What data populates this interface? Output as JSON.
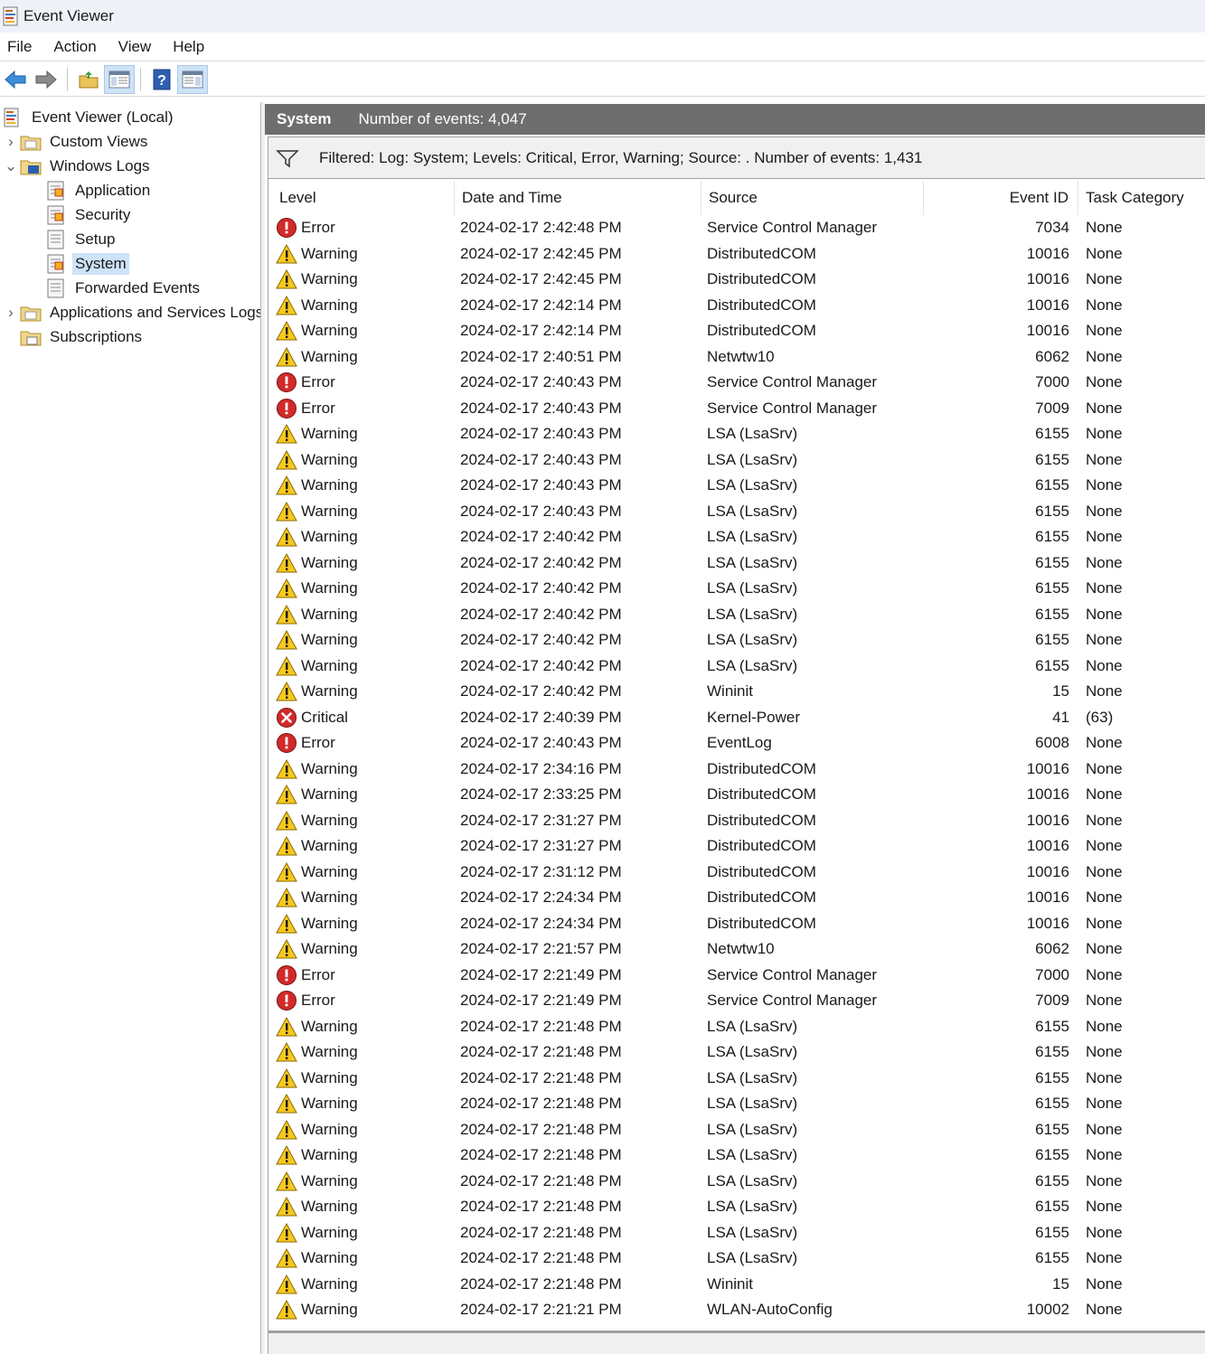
{
  "window": {
    "title": "Event Viewer"
  },
  "menu": [
    "File",
    "Action",
    "View",
    "Help"
  ],
  "toolbar": {
    "buttons": [
      "back-arrow-icon",
      "forward-arrow-icon",
      "open-folder-icon",
      "show-hide-tree-icon",
      "help-icon",
      "show-hide-action-pane-icon"
    ]
  },
  "tree": {
    "items": [
      {
        "label": "Event Viewer (Local)",
        "icon": "event-viewer-icon",
        "level": 0,
        "chevron": ""
      },
      {
        "label": "Custom Views",
        "icon": "folder-icon",
        "level": 1,
        "chevron": "›"
      },
      {
        "label": "Windows Logs",
        "icon": "windows-logs-folder-icon",
        "level": 1,
        "chevron": "⌄"
      },
      {
        "label": "Application",
        "icon": "log-icon",
        "level": 2,
        "chevron": ""
      },
      {
        "label": "Security",
        "icon": "log-icon",
        "level": 2,
        "chevron": ""
      },
      {
        "label": "Setup",
        "icon": "log-icon",
        "level": 2,
        "chevron": ""
      },
      {
        "label": "System",
        "icon": "log-icon",
        "level": 2,
        "chevron": "",
        "selected": true
      },
      {
        "label": "Forwarded Events",
        "icon": "log-icon",
        "level": 2,
        "chevron": ""
      },
      {
        "label": "Applications and Services Logs",
        "icon": "folder-icon",
        "level": 1,
        "chevron": "›"
      },
      {
        "label": "Subscriptions",
        "icon": "subscriptions-icon",
        "level": 1,
        "chevron": ""
      }
    ]
  },
  "log_header": {
    "name": "System",
    "count": "Number of events: 4,047"
  },
  "filter": {
    "text": "Filtered: Log: System; Levels: Critical, Error, Warning; Source: . Number of events: 1,431"
  },
  "columns": [
    "Level",
    "Date and Time",
    "Source",
    "Event ID",
    "Task Category"
  ],
  "colors": {
    "warning": "#f7c81e",
    "error": "#d12a2a",
    "critical": "#d12a2a",
    "selection": "#cde3f7",
    "header": "#6e6e6e"
  },
  "events": [
    {
      "level": "Error",
      "datetime": "2024-02-17 2:42:48 PM",
      "source": "Service Control Manager",
      "event_id": "7034",
      "category": "None"
    },
    {
      "level": "Warning",
      "datetime": "2024-02-17 2:42:45 PM",
      "source": "DistributedCOM",
      "event_id": "10016",
      "category": "None"
    },
    {
      "level": "Warning",
      "datetime": "2024-02-17 2:42:45 PM",
      "source": "DistributedCOM",
      "event_id": "10016",
      "category": "None"
    },
    {
      "level": "Warning",
      "datetime": "2024-02-17 2:42:14 PM",
      "source": "DistributedCOM",
      "event_id": "10016",
      "category": "None"
    },
    {
      "level": "Warning",
      "datetime": "2024-02-17 2:42:14 PM",
      "source": "DistributedCOM",
      "event_id": "10016",
      "category": "None"
    },
    {
      "level": "Warning",
      "datetime": "2024-02-17 2:40:51 PM",
      "source": "Netwtw10",
      "event_id": "6062",
      "category": "None"
    },
    {
      "level": "Error",
      "datetime": "2024-02-17 2:40:43 PM",
      "source": "Service Control Manager",
      "event_id": "7000",
      "category": "None"
    },
    {
      "level": "Error",
      "datetime": "2024-02-17 2:40:43 PM",
      "source": "Service Control Manager",
      "event_id": "7009",
      "category": "None"
    },
    {
      "level": "Warning",
      "datetime": "2024-02-17 2:40:43 PM",
      "source": "LSA (LsaSrv)",
      "event_id": "6155",
      "category": "None"
    },
    {
      "level": "Warning",
      "datetime": "2024-02-17 2:40:43 PM",
      "source": "LSA (LsaSrv)",
      "event_id": "6155",
      "category": "None"
    },
    {
      "level": "Warning",
      "datetime": "2024-02-17 2:40:43 PM",
      "source": "LSA (LsaSrv)",
      "event_id": "6155",
      "category": "None"
    },
    {
      "level": "Warning",
      "datetime": "2024-02-17 2:40:43 PM",
      "source": "LSA (LsaSrv)",
      "event_id": "6155",
      "category": "None"
    },
    {
      "level": "Warning",
      "datetime": "2024-02-17 2:40:42 PM",
      "source": "LSA (LsaSrv)",
      "event_id": "6155",
      "category": "None"
    },
    {
      "level": "Warning",
      "datetime": "2024-02-17 2:40:42 PM",
      "source": "LSA (LsaSrv)",
      "event_id": "6155",
      "category": "None"
    },
    {
      "level": "Warning",
      "datetime": "2024-02-17 2:40:42 PM",
      "source": "LSA (LsaSrv)",
      "event_id": "6155",
      "category": "None"
    },
    {
      "level": "Warning",
      "datetime": "2024-02-17 2:40:42 PM",
      "source": "LSA (LsaSrv)",
      "event_id": "6155",
      "category": "None"
    },
    {
      "level": "Warning",
      "datetime": "2024-02-17 2:40:42 PM",
      "source": "LSA (LsaSrv)",
      "event_id": "6155",
      "category": "None"
    },
    {
      "level": "Warning",
      "datetime": "2024-02-17 2:40:42 PM",
      "source": "LSA (LsaSrv)",
      "event_id": "6155",
      "category": "None"
    },
    {
      "level": "Warning",
      "datetime": "2024-02-17 2:40:42 PM",
      "source": "Wininit",
      "event_id": "15",
      "category": "None"
    },
    {
      "level": "Critical",
      "datetime": "2024-02-17 2:40:39 PM",
      "source": "Kernel-Power",
      "event_id": "41",
      "category": "(63)"
    },
    {
      "level": "Error",
      "datetime": "2024-02-17 2:40:43 PM",
      "source": "EventLog",
      "event_id": "6008",
      "category": "None"
    },
    {
      "level": "Warning",
      "datetime": "2024-02-17 2:34:16 PM",
      "source": "DistributedCOM",
      "event_id": "10016",
      "category": "None"
    },
    {
      "level": "Warning",
      "datetime": "2024-02-17 2:33:25 PM",
      "source": "DistributedCOM",
      "event_id": "10016",
      "category": "None"
    },
    {
      "level": "Warning",
      "datetime": "2024-02-17 2:31:27 PM",
      "source": "DistributedCOM",
      "event_id": "10016",
      "category": "None"
    },
    {
      "level": "Warning",
      "datetime": "2024-02-17 2:31:27 PM",
      "source": "DistributedCOM",
      "event_id": "10016",
      "category": "None"
    },
    {
      "level": "Warning",
      "datetime": "2024-02-17 2:31:12 PM",
      "source": "DistributedCOM",
      "event_id": "10016",
      "category": "None"
    },
    {
      "level": "Warning",
      "datetime": "2024-02-17 2:24:34 PM",
      "source": "DistributedCOM",
      "event_id": "10016",
      "category": "None"
    },
    {
      "level": "Warning",
      "datetime": "2024-02-17 2:24:34 PM",
      "source": "DistributedCOM",
      "event_id": "10016",
      "category": "None"
    },
    {
      "level": "Warning",
      "datetime": "2024-02-17 2:21:57 PM",
      "source": "Netwtw10",
      "event_id": "6062",
      "category": "None"
    },
    {
      "level": "Error",
      "datetime": "2024-02-17 2:21:49 PM",
      "source": "Service Control Manager",
      "event_id": "7000",
      "category": "None"
    },
    {
      "level": "Error",
      "datetime": "2024-02-17 2:21:49 PM",
      "source": "Service Control Manager",
      "event_id": "7009",
      "category": "None"
    },
    {
      "level": "Warning",
      "datetime": "2024-02-17 2:21:48 PM",
      "source": "LSA (LsaSrv)",
      "event_id": "6155",
      "category": "None"
    },
    {
      "level": "Warning",
      "datetime": "2024-02-17 2:21:48 PM",
      "source": "LSA (LsaSrv)",
      "event_id": "6155",
      "category": "None"
    },
    {
      "level": "Warning",
      "datetime": "2024-02-17 2:21:48 PM",
      "source": "LSA (LsaSrv)",
      "event_id": "6155",
      "category": "None"
    },
    {
      "level": "Warning",
      "datetime": "2024-02-17 2:21:48 PM",
      "source": "LSA (LsaSrv)",
      "event_id": "6155",
      "category": "None"
    },
    {
      "level": "Warning",
      "datetime": "2024-02-17 2:21:48 PM",
      "source": "LSA (LsaSrv)",
      "event_id": "6155",
      "category": "None"
    },
    {
      "level": "Warning",
      "datetime": "2024-02-17 2:21:48 PM",
      "source": "LSA (LsaSrv)",
      "event_id": "6155",
      "category": "None"
    },
    {
      "level": "Warning",
      "datetime": "2024-02-17 2:21:48 PM",
      "source": "LSA (LsaSrv)",
      "event_id": "6155",
      "category": "None"
    },
    {
      "level": "Warning",
      "datetime": "2024-02-17 2:21:48 PM",
      "source": "LSA (LsaSrv)",
      "event_id": "6155",
      "category": "None"
    },
    {
      "level": "Warning",
      "datetime": "2024-02-17 2:21:48 PM",
      "source": "LSA (LsaSrv)",
      "event_id": "6155",
      "category": "None"
    },
    {
      "level": "Warning",
      "datetime": "2024-02-17 2:21:48 PM",
      "source": "LSA (LsaSrv)",
      "event_id": "6155",
      "category": "None"
    },
    {
      "level": "Warning",
      "datetime": "2024-02-17 2:21:48 PM",
      "source": "Wininit",
      "event_id": "15",
      "category": "None"
    },
    {
      "level": "Warning",
      "datetime": "2024-02-17 2:21:21 PM",
      "source": "WLAN-AutoConfig",
      "event_id": "10002",
      "category": "None"
    }
  ]
}
